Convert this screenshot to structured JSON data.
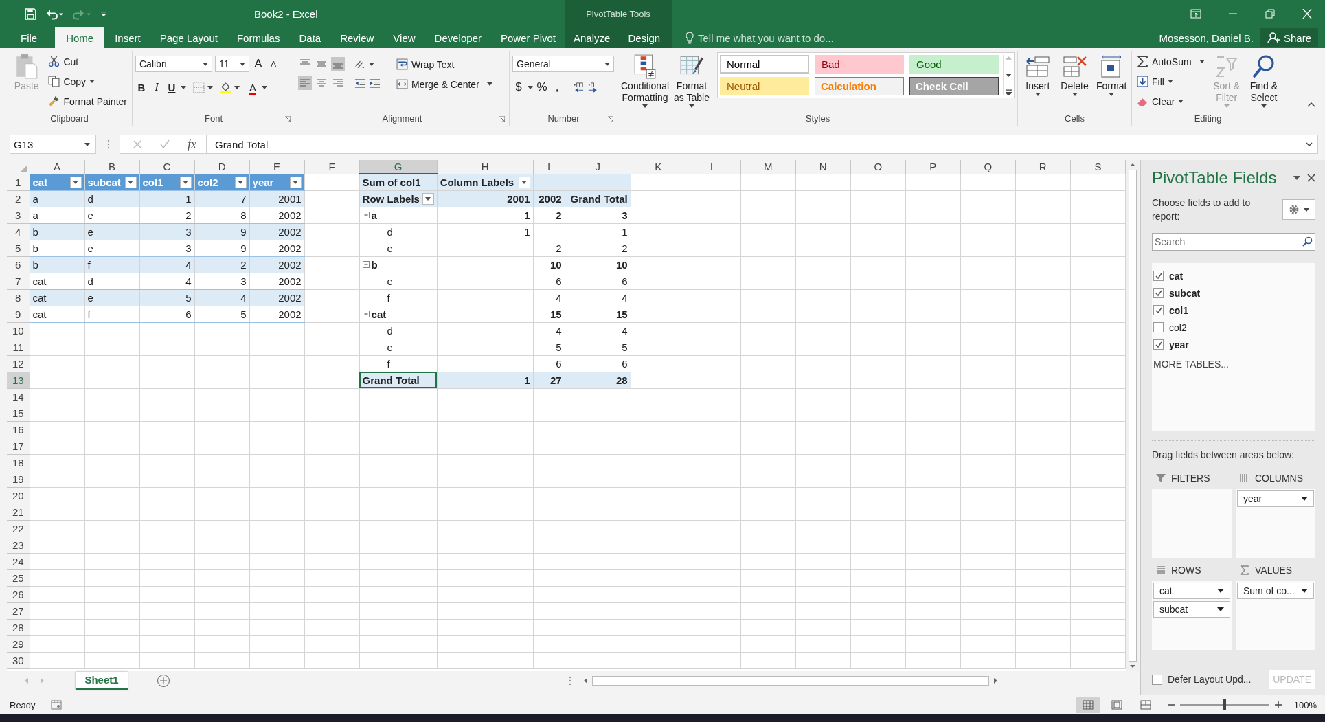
{
  "window": {
    "title": "Book2 - Excel",
    "context_title": "PivotTable Tools"
  },
  "qat": [
    {
      "kind": "save",
      "disabled": false
    },
    {
      "kind": "undo",
      "disabled": false
    },
    {
      "kind": "redo",
      "disabled": true
    },
    {
      "kind": "customize",
      "disabled": false
    }
  ],
  "ribbon_tabs": [
    {
      "label": "File",
      "selected": false,
      "kind": "main"
    },
    {
      "label": "Home",
      "selected": true,
      "kind": "main"
    },
    {
      "label": "Insert",
      "selected": false,
      "kind": "main"
    },
    {
      "label": "Page Layout",
      "selected": false,
      "kind": "main"
    },
    {
      "label": "Formulas",
      "selected": false,
      "kind": "main"
    },
    {
      "label": "Data",
      "selected": false,
      "kind": "main"
    },
    {
      "label": "Review",
      "selected": false,
      "kind": "main"
    },
    {
      "label": "View",
      "selected": false,
      "kind": "main"
    },
    {
      "label": "Developer",
      "selected": false,
      "kind": "main"
    },
    {
      "label": "Power Pivot",
      "selected": false,
      "kind": "main"
    },
    {
      "label": "Analyze",
      "selected": false,
      "kind": "context"
    },
    {
      "label": "Design",
      "selected": false,
      "kind": "context"
    }
  ],
  "tell_me": "Tell me what you want to do...",
  "user": "Mosesson, Daniel B.",
  "share": "Share",
  "ribbon": {
    "clipboard": {
      "label": "Clipboard",
      "paste": {
        "label": "Paste",
        "disabled": true
      },
      "cut": "Cut",
      "copy": "Copy",
      "format_painter": "Format Painter"
    },
    "font": {
      "label": "Font",
      "name": "Calibri",
      "size": "11",
      "grow": "A",
      "shrink": "A",
      "bold": "B",
      "italic": "I",
      "underline": "U",
      "font_color": "A"
    },
    "alignment": {
      "label": "Alignment",
      "vertical": [
        {
          "kind": "top",
          "selected": false
        },
        {
          "kind": "middle",
          "selected": false
        },
        {
          "kind": "bottom",
          "selected": true
        }
      ],
      "horizontal": [
        {
          "kind": "left",
          "selected": true
        },
        {
          "kind": "center",
          "selected": false
        },
        {
          "kind": "right",
          "selected": false
        }
      ],
      "wrap": "Wrap Text",
      "merge": "Merge & Center"
    },
    "number": {
      "label": "Number",
      "format": "General",
      "currency": "$",
      "percent": "%",
      "comma": ","
    },
    "styles": {
      "label": "Styles",
      "conditional": "Conditional Formatting",
      "format_table": "Format as Table",
      "gallery": [
        {
          "label": "Normal",
          "color": "#ffffff",
          "kind": "normal",
          "bold": false
        },
        {
          "label": "Bad",
          "color": "#ffc7ce",
          "kind": "bad",
          "bold": false
        },
        {
          "label": "Good",
          "color": "#c6efce",
          "kind": "good",
          "bold": false
        },
        {
          "label": "Neutral",
          "color": "#ffeb9c",
          "kind": "neutral",
          "bold": false
        },
        {
          "label": "Calculation",
          "color": "#f2f2f2",
          "kind": "calculation",
          "bold": true
        },
        {
          "label": "Check Cell",
          "color": "#a5a5a5",
          "kind": "check",
          "bold": true
        }
      ]
    },
    "cells": {
      "label": "Cells",
      "buttons": [
        {
          "label": "Insert",
          "kind": "insert"
        },
        {
          "label": "Delete",
          "kind": "delete"
        },
        {
          "label": "Format",
          "kind": "format"
        }
      ]
    },
    "editing": {
      "label": "Editing",
      "autosum": "AutoSum",
      "fill": "Fill",
      "clear": "Clear",
      "sort": {
        "label": "Sort & Filter",
        "disabled": true
      },
      "find": "Find & Select"
    }
  },
  "formula_bar": {
    "name_box": "G13",
    "fx": "fx",
    "value": "Grand Total"
  },
  "sheet": {
    "columns": [
      {
        "letter": "A",
        "selected": false
      },
      {
        "letter": "B",
        "selected": false
      },
      {
        "letter": "C",
        "selected": false
      },
      {
        "letter": "D",
        "selected": false
      },
      {
        "letter": "E",
        "selected": false
      },
      {
        "letter": "F",
        "selected": false
      },
      {
        "letter": "G",
        "selected": true
      },
      {
        "letter": "H",
        "selected": false
      },
      {
        "letter": "I",
        "selected": false
      },
      {
        "letter": "J",
        "selected": false
      },
      {
        "letter": "K",
        "selected": false
      },
      {
        "letter": "L",
        "selected": false
      },
      {
        "letter": "M",
        "selected": false
      },
      {
        "letter": "N",
        "selected": false
      },
      {
        "letter": "O",
        "selected": false
      },
      {
        "letter": "P",
        "selected": false
      },
      {
        "letter": "Q",
        "selected": false
      },
      {
        "letter": "R",
        "selected": false
      },
      {
        "letter": "S",
        "selected": false
      }
    ],
    "rows": [
      {
        "number": "1",
        "selected": false,
        "cells": {
          "A": {
            "text": "cat",
            "kind": "table_header",
            "filter": true
          },
          "B": {
            "text": "subcat",
            "kind": "table_header",
            "filter": true
          },
          "C": {
            "text": "col1",
            "kind": "table_header",
            "filter": true
          },
          "D": {
            "text": "col2",
            "kind": "table_header",
            "filter": true
          },
          "E": {
            "text": "year",
            "kind": "table_header",
            "filter": true
          },
          "G": {
            "text": "Sum of col1",
            "kind": "pivot_header"
          },
          "H": {
            "text": "Column Labels",
            "kind": "pivot_header",
            "filter": true
          },
          "I": {
            "kind": "pivot_header"
          },
          "J": {
            "kind": "pivot_header"
          }
        }
      },
      {
        "number": "2",
        "selected": false,
        "cells": {
          "A": {
            "text": "a",
            "kind": "table_band"
          },
          "B": {
            "text": "d",
            "kind": "table_band"
          },
          "C": {
            "text": "1",
            "kind": "table_band"
          },
          "D": {
            "text": "7",
            "kind": "table_band"
          },
          "E": {
            "text": "2001",
            "kind": "table_band"
          },
          "G": {
            "text": "Row Labels",
            "kind": "pivot_header",
            "filter": true
          },
          "H": {
            "text": "2001",
            "kind": "pivot_header"
          },
          "I": {
            "text": "2002",
            "kind": "pivot_header"
          },
          "J": {
            "text": "Grand Total",
            "kind": "pivot_header"
          }
        }
      },
      {
        "number": "3",
        "selected": false,
        "cells": {
          "A": {
            "text": "a",
            "kind": "table_plain"
          },
          "B": {
            "text": "e",
            "kind": "table_plain"
          },
          "C": {
            "text": "2",
            "kind": "table_plain"
          },
          "D": {
            "text": "8",
            "kind": "table_plain"
          },
          "E": {
            "text": "2002",
            "kind": "table_plain"
          },
          "G": {
            "text": "a",
            "kind": "pivot_group",
            "expanded": true
          },
          "H": {
            "text": "1",
            "kind": "pivot_group"
          },
          "I": {
            "text": "2",
            "kind": "pivot_group"
          },
          "J": {
            "text": "3",
            "kind": "pivot_group"
          }
        }
      },
      {
        "number": "4",
        "selected": false,
        "cells": {
          "A": {
            "text": "b",
            "kind": "table_band"
          },
          "B": {
            "text": "e",
            "kind": "table_band"
          },
          "C": {
            "text": "3",
            "kind": "table_band"
          },
          "D": {
            "text": "9",
            "kind": "table_band"
          },
          "E": {
            "text": "2002",
            "kind": "table_band"
          },
          "G": {
            "text": "d",
            "kind": "pivot_item"
          },
          "H": {
            "text": "1",
            "kind": "pivot_item"
          },
          "J": {
            "text": "1",
            "kind": "pivot_item"
          }
        }
      },
      {
        "number": "5",
        "selected": false,
        "cells": {
          "A": {
            "text": "b",
            "kind": "table_plain"
          },
          "B": {
            "text": "e",
            "kind": "table_plain"
          },
          "C": {
            "text": "3",
            "kind": "table_plain"
          },
          "D": {
            "text": "9",
            "kind": "table_plain"
          },
          "E": {
            "text": "2002",
            "kind": "table_plain"
          },
          "G": {
            "text": "e",
            "kind": "pivot_item"
          },
          "I": {
            "text": "2",
            "kind": "pivot_item"
          },
          "J": {
            "text": "2",
            "kind": "pivot_item"
          }
        }
      },
      {
        "number": "6",
        "selected": false,
        "cells": {
          "A": {
            "text": "b",
            "kind": "table_band"
          },
          "B": {
            "text": "f",
            "kind": "table_band"
          },
          "C": {
            "text": "4",
            "kind": "table_band"
          },
          "D": {
            "text": "2",
            "kind": "table_band"
          },
          "E": {
            "text": "2002",
            "kind": "table_band"
          },
          "G": {
            "text": "b",
            "kind": "pivot_group",
            "expanded": true
          },
          "H": {
            "kind": "pivot_group"
          },
          "I": {
            "text": "10",
            "kind": "pivot_group"
          },
          "J": {
            "text": "10",
            "kind": "pivot_group"
          }
        }
      },
      {
        "number": "7",
        "selected": false,
        "cells": {
          "A": {
            "text": "cat",
            "kind": "table_plain"
          },
          "B": {
            "text": "d",
            "kind": "table_plain"
          },
          "C": {
            "text": "4",
            "kind": "table_plain"
          },
          "D": {
            "text": "3",
            "kind": "table_plain"
          },
          "E": {
            "text": "2002",
            "kind": "table_plain"
          },
          "G": {
            "text": "e",
            "kind": "pivot_item"
          },
          "I": {
            "text": "6",
            "kind": "pivot_item"
          },
          "J": {
            "text": "6",
            "kind": "pivot_item"
          }
        }
      },
      {
        "number": "8",
        "selected": false,
        "cells": {
          "A": {
            "text": "cat",
            "kind": "table_band"
          },
          "B": {
            "text": "e",
            "kind": "table_band"
          },
          "C": {
            "text": "5",
            "kind": "table_band"
          },
          "D": {
            "text": "4",
            "kind": "table_band"
          },
          "E": {
            "text": "2002",
            "kind": "table_band"
          },
          "G": {
            "text": "f",
            "kind": "pivot_item"
          },
          "I": {
            "text": "4",
            "kind": "pivot_item"
          },
          "J": {
            "text": "4",
            "kind": "pivot_item"
          }
        }
      },
      {
        "number": "9",
        "selected": false,
        "cells": {
          "A": {
            "text": "cat",
            "kind": "table_plain"
          },
          "B": {
            "text": "f",
            "kind": "table_plain"
          },
          "C": {
            "text": "6",
            "kind": "table_plain"
          },
          "D": {
            "text": "5",
            "kind": "table_plain"
          },
          "E": {
            "text": "2002",
            "kind": "table_plain"
          },
          "G": {
            "text": "cat",
            "kind": "pivot_group",
            "expanded": true
          },
          "H": {
            "kind": "pivot_group"
          },
          "I": {
            "text": "15",
            "kind": "pivot_group"
          },
          "J": {
            "text": "15",
            "kind": "pivot_group"
          }
        }
      },
      {
        "number": "10",
        "selected": false,
        "cells": {
          "G": {
            "text": "d",
            "kind": "pivot_item"
          },
          "I": {
            "text": "4",
            "kind": "pivot_item"
          },
          "J": {
            "text": "4",
            "kind": "pivot_item"
          }
        }
      },
      {
        "number": "11",
        "selected": false,
        "cells": {
          "G": {
            "text": "e",
            "kind": "pivot_item"
          },
          "I": {
            "text": "5",
            "kind": "pivot_item"
          },
          "J": {
            "text": "5",
            "kind": "pivot_item"
          }
        }
      },
      {
        "number": "12",
        "selected": false,
        "cells": {
          "G": {
            "text": "f",
            "kind": "pivot_item"
          },
          "I": {
            "text": "6",
            "kind": "pivot_item"
          },
          "J": {
            "text": "6",
            "kind": "pivot_item"
          }
        }
      },
      {
        "number": "13",
        "selected": true,
        "cells": {
          "G": {
            "text": "Grand Total",
            "kind": "pivot_total"
          },
          "H": {
            "text": "1",
            "kind": "pivot_total"
          },
          "I": {
            "text": "27",
            "kind": "pivot_total"
          },
          "J": {
            "text": "28",
            "kind": "pivot_total"
          }
        }
      },
      {
        "number": "14",
        "selected": false
      },
      {
        "number": "15",
        "selected": false
      },
      {
        "number": "16",
        "selected": false
      },
      {
        "number": "17",
        "selected": false
      },
      {
        "number": "18",
        "selected": false
      },
      {
        "number": "19",
        "selected": false
      },
      {
        "number": "20",
        "selected": false
      },
      {
        "number": "21",
        "selected": false
      },
      {
        "number": "22",
        "selected": false
      },
      {
        "number": "23",
        "selected": false
      },
      {
        "number": "24",
        "selected": false
      },
      {
        "number": "25",
        "selected": false
      },
      {
        "number": "26",
        "selected": false
      },
      {
        "number": "27",
        "selected": false
      },
      {
        "number": "28",
        "selected": false
      },
      {
        "number": "29",
        "selected": false
      },
      {
        "number": "30",
        "selected": false
      }
    ]
  },
  "pane": {
    "title": "PivotTable Fields",
    "choose": "Choose fields to add to report:",
    "search_placeholder": "Search",
    "fields": [
      {
        "name": "cat",
        "checked": true
      },
      {
        "name": "subcat",
        "checked": true
      },
      {
        "name": "col1",
        "checked": true
      },
      {
        "name": "col2",
        "checked": false
      },
      {
        "name": "year",
        "checked": true
      }
    ],
    "more": "MORE TABLES...",
    "drag": "Drag fields between areas below:",
    "areas": [
      {
        "kind": "filters",
        "label": "FILTERS"
      },
      {
        "kind": "columns",
        "label": "COLUMNS",
        "items": [
          "year"
        ]
      },
      {
        "kind": "rows",
        "label": "ROWS",
        "items": [
          "cat",
          "subcat"
        ]
      },
      {
        "kind": "values",
        "label": "VALUES",
        "items": [
          "Sum of co..."
        ]
      }
    ],
    "defer": {
      "label": "Defer Layout Upd...",
      "checked": false
    },
    "update": {
      "label": "UPDATE",
      "disabled": true
    }
  },
  "sheet_tabs": [
    {
      "label": "Sheet1",
      "selected": true
    }
  ],
  "status": {
    "text": "Ready",
    "views": [
      {
        "kind": "normal",
        "selected": true
      },
      {
        "kind": "page_layout",
        "selected": false
      },
      {
        "kind": "page_break",
        "selected": false
      }
    ],
    "zoom_slider": {
      "level": 0.5
    },
    "zoom": "100%"
  }
}
